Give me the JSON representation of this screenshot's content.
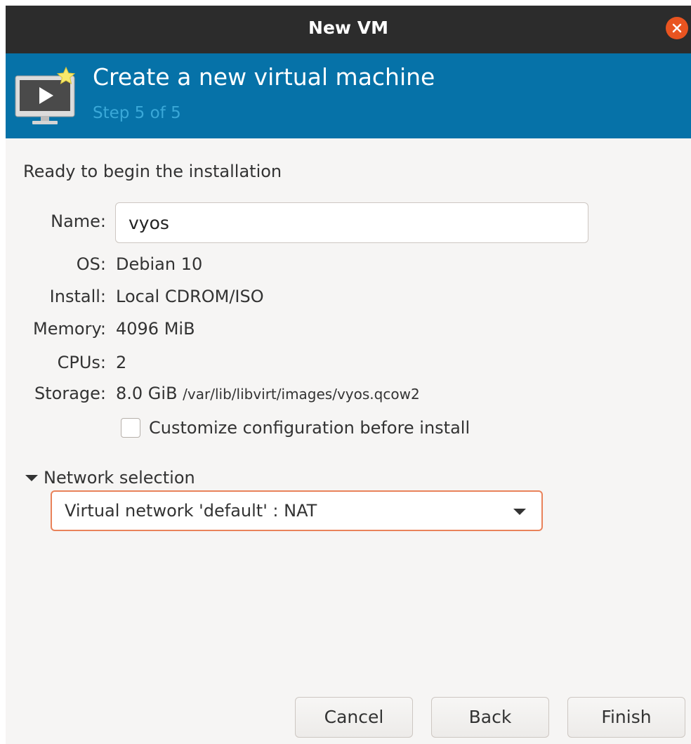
{
  "window": {
    "title": "New VM"
  },
  "header": {
    "title": "Create a new virtual machine",
    "subtitle": "Step 5 of 5",
    "icon": "vm-monitor-play-icon"
  },
  "content": {
    "ready_label": "Ready to begin the installation",
    "name": {
      "label": "Name:",
      "value": "vyos"
    },
    "os": {
      "label": "OS:",
      "value": "Debian 10"
    },
    "install": {
      "label": "Install:",
      "value": "Local CDROM/ISO"
    },
    "memory": {
      "label": "Memory:",
      "value": "4096 MiB"
    },
    "cpus": {
      "label": "CPUs:",
      "value": "2"
    },
    "storage": {
      "label": "Storage:",
      "size": "8.0 GiB",
      "path": "/var/lib/libvirt/images/vyos.qcow2"
    },
    "customize": {
      "label": "Customize configuration before install",
      "checked": false
    }
  },
  "network": {
    "expander_label": "Network selection",
    "expanded": true,
    "selected": "Virtual network 'default' : NAT"
  },
  "buttons": {
    "cancel": "Cancel",
    "back": "Back",
    "finish": "Finish"
  },
  "colors": {
    "titlebar": "#2c2c2c",
    "banner": "#0672a8",
    "subtitle": "#3aa8d8",
    "close": "#e95420",
    "focus_border": "#e9825a"
  }
}
